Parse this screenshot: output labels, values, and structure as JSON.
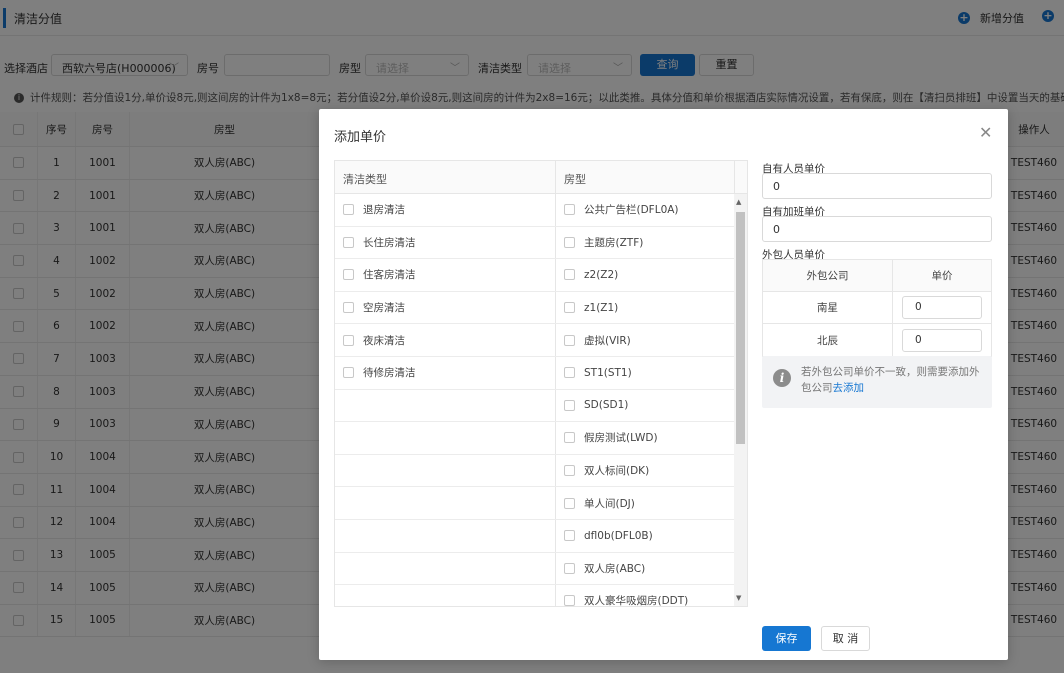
{
  "header": {
    "title": "清洁分值",
    "add_label": "新增分值"
  },
  "filter": {
    "hotel_label": "选择酒店",
    "hotel_value": "西软六号店(H000006)",
    "room_no_label": "房号",
    "room_no_value": "",
    "room_type_label": "房型",
    "room_type_placeholder": "请选择",
    "clean_type_label": "清洁类型",
    "clean_type_placeholder": "请选择",
    "query_label": "查询",
    "reset_label": "重置"
  },
  "rule_text": "计件规则：若分值设1分,单价设8元,则这间房的计件为1x8=8元；若分值设2分,单价设8元,则这间房的计件为2x8=16元；以此类推。具体分值和单价根据酒店实际情况设置，若有保底，则在【清扫员排班】中设置当天的基础",
  "table": {
    "headers": [
      "序号",
      "房号",
      "房型",
      "操作人"
    ],
    "rows": [
      {
        "seq": "1",
        "room": "1001",
        "type": "双人房(ABC)",
        "op": "TEST460"
      },
      {
        "seq": "2",
        "room": "1001",
        "type": "双人房(ABC)",
        "op": "TEST460"
      },
      {
        "seq": "3",
        "room": "1001",
        "type": "双人房(ABC)",
        "op": "TEST460"
      },
      {
        "seq": "4",
        "room": "1002",
        "type": "双人房(ABC)",
        "op": "TEST460"
      },
      {
        "seq": "5",
        "room": "1002",
        "type": "双人房(ABC)",
        "op": "TEST460"
      },
      {
        "seq": "6",
        "room": "1002",
        "type": "双人房(ABC)",
        "op": "TEST460"
      },
      {
        "seq": "7",
        "room": "1003",
        "type": "双人房(ABC)",
        "op": "TEST460"
      },
      {
        "seq": "8",
        "room": "1003",
        "type": "双人房(ABC)",
        "op": "TEST460"
      },
      {
        "seq": "9",
        "room": "1003",
        "type": "双人房(ABC)",
        "op": "TEST460"
      },
      {
        "seq": "10",
        "room": "1004",
        "type": "双人房(ABC)",
        "op": "TEST460"
      },
      {
        "seq": "11",
        "room": "1004",
        "type": "双人房(ABC)",
        "op": "TEST460"
      },
      {
        "seq": "12",
        "room": "1004",
        "type": "双人房(ABC)",
        "op": "TEST460"
      },
      {
        "seq": "13",
        "room": "1005",
        "type": "双人房(ABC)",
        "op": "TEST460"
      },
      {
        "seq": "14",
        "room": "1005",
        "type": "双人房(ABC)",
        "op": "TEST460"
      },
      {
        "seq": "15",
        "room": "1005",
        "type": "双人房(ABC)",
        "op": "TEST460"
      }
    ]
  },
  "modal": {
    "title": "添加单价",
    "col_clean_type": "清洁类型",
    "col_room_type": "房型",
    "clean_types": [
      "退房清洁",
      "长住房清洁",
      "住客房清洁",
      "空房清洁",
      "夜床清洁",
      "待修房清洁"
    ],
    "room_types": [
      "公共广告栏(DFL0A)",
      "主题房(ZTF)",
      "z2(Z2)",
      "z1(Z1)",
      "虚拟(VIR)",
      "ST1(ST1)",
      "SD(SD1)",
      "假房测试(LWD)",
      "双人标间(DK)",
      "单人间(DJ)",
      "dfl0b(DFL0B)",
      "双人房(ABC)",
      "双人豪华吸烟房(DDT)"
    ],
    "own_price_label": "自有人员单价",
    "own_price_value": "0",
    "overtime_price_label": "自有加班单价",
    "overtime_price_value": "0",
    "outsource_label": "外包人员单价",
    "outsource_col_company": "外包公司",
    "outsource_col_price": "单价",
    "outsource_rows": [
      {
        "company": "南星",
        "price": "0"
      },
      {
        "company": "北辰",
        "price": "0"
      }
    ],
    "tip_text": "若外包公司单价不一致，则需要添加外包公司",
    "tip_link": "去添加",
    "save_label": "保存",
    "cancel_label": "取 消"
  },
  "colors": {
    "primary": "#1677d2",
    "overlay": "rgba(0,0,0,0.5)"
  }
}
